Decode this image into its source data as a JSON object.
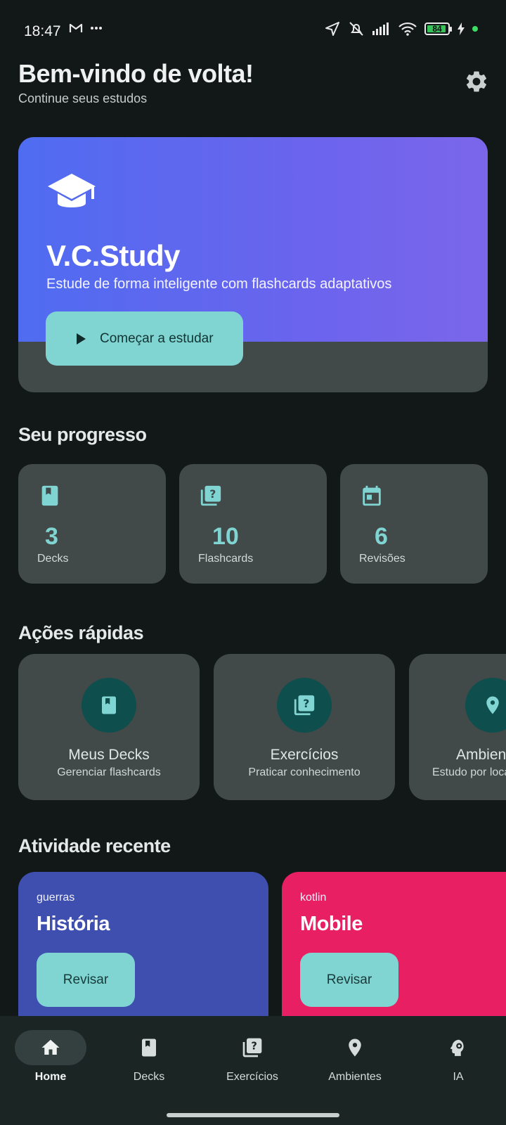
{
  "status_bar": {
    "time": "18:47",
    "battery": "84"
  },
  "header": {
    "title": "Bem-vindo de volta!",
    "subtitle": "Continue seus estudos",
    "settings_icon": "gear-icon"
  },
  "hero": {
    "title": "V.C.Study",
    "description": "Estude de forma inteligente com flashcards adaptativos",
    "button_label": "Começar a estudar",
    "gradient_start": "#4f6cf0",
    "gradient_end": "#7b66ea"
  },
  "progress": {
    "title": "Seu progresso",
    "stats": [
      {
        "value": "3",
        "label": "Decks",
        "icon": "book-icon"
      },
      {
        "value": "10",
        "label": "Flashcards",
        "icon": "quiz-icon"
      },
      {
        "value": "6",
        "label": "Revisões",
        "icon": "calendar-icon"
      }
    ]
  },
  "quick_actions": {
    "title": "Ações rápidas",
    "items": [
      {
        "name": "Meus Decks",
        "hint": "Gerenciar flashcards",
        "icon": "book-icon"
      },
      {
        "name": "Exercícios",
        "hint": "Praticar conhecimento",
        "icon": "quiz-icon"
      },
      {
        "name": "Ambientes",
        "hint": "Estudo por localização",
        "icon": "location-pin-icon"
      }
    ]
  },
  "recent": {
    "title": "Atividade recente",
    "items": [
      {
        "tag": "guerras",
        "subject": "História",
        "button": "Revisar",
        "color": "#3e4fb0"
      },
      {
        "tag": "kotlin",
        "subject": "Mobile",
        "button": "Revisar",
        "color": "#e91f63"
      }
    ]
  },
  "bottom_nav": {
    "items": [
      {
        "label": "Home",
        "icon": "home-icon",
        "active": true
      },
      {
        "label": "Decks",
        "icon": "book-icon"
      },
      {
        "label": "Exercícios",
        "icon": "quiz-icon"
      },
      {
        "label": "Ambientes",
        "icon": "location-pin-icon"
      },
      {
        "label": "IA",
        "icon": "psychology-icon"
      }
    ]
  },
  "colors": {
    "accent": "#80d5d3",
    "background": "#111817",
    "card": "#414949"
  }
}
